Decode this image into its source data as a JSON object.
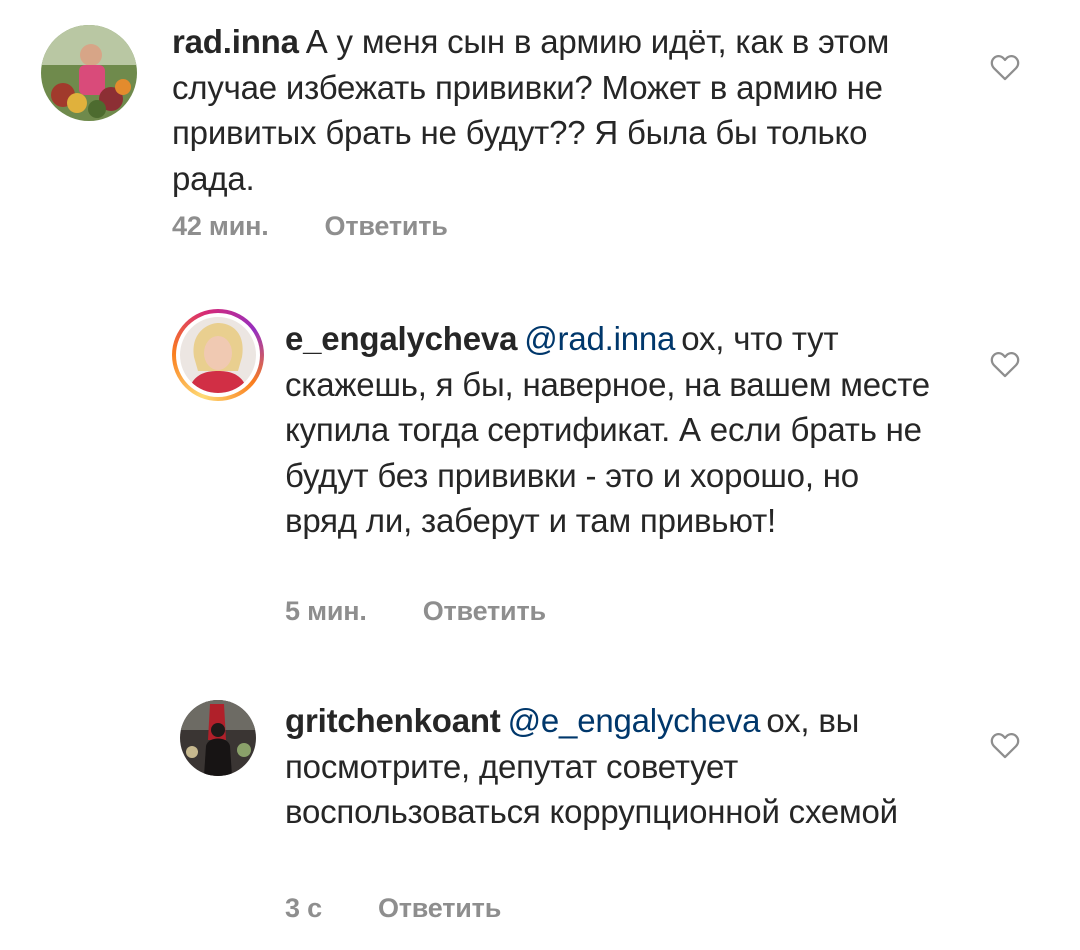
{
  "comments": [
    {
      "username": "rad.inna",
      "mention": "",
      "text": "А у меня сын в армию идёт, как в этом случае избежать прививки? Может в армию не привитых брать не будут?? Я была бы только рада.",
      "time": "42 мин.",
      "reply_label": "Ответить",
      "like_icon": "heart-outline-icon"
    },
    {
      "username": "e_engalycheva",
      "mention": "@rad.inna",
      "text": "ох, что тут скажешь, я бы, наверное, на вашем месте купила тогда сертификат. А если брать не будут без прививки - это и хорошо, но вряд ли, заберут и там привьют!",
      "time": "5 мин.",
      "reply_label": "Ответить",
      "like_icon": "heart-outline-icon"
    },
    {
      "username": "gritchenkoant",
      "mention": "@e_engalycheva",
      "text": "ох, вы посмотрите, депутат советует воспользоваться коррупционной схемой",
      "time": "3 с",
      "reply_label": "Ответить",
      "like_icon": "heart-outline-icon"
    }
  ],
  "colors": {
    "text": "#262626",
    "secondary": "#8e8e8e",
    "mention": "#00376b"
  }
}
